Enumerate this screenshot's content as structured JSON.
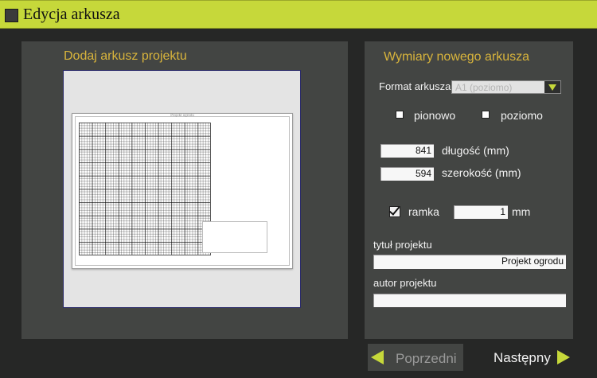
{
  "window": {
    "title": "Edycja arkusza"
  },
  "left_panel": {
    "title": "Dodaj arkusz projektu",
    "sheet_title": "Projekt ogrodu"
  },
  "right_panel": {
    "title": "Wymiary nowego arkusza",
    "format_label": "Format arkusza",
    "format_value": "A1 (poziomo)",
    "orientation": {
      "portrait": "pionowo",
      "landscape": "poziomo"
    },
    "length": {
      "value": "841",
      "label": "długość (mm)"
    },
    "width": {
      "value": "594",
      "label": "szerokość (mm)"
    },
    "frame": {
      "label": "ramka",
      "checked": true,
      "value": "1",
      "unit": "mm"
    },
    "project_title": {
      "label": "tytuł projektu",
      "value": "Projekt ogrodu"
    },
    "project_author": {
      "label": "autor projektu",
      "value": ""
    }
  },
  "navigation": {
    "prev": "Poprzedni",
    "next": "Następny"
  },
  "colors": {
    "accent": "#c6d83a",
    "heading": "#d8b43c",
    "panel": "#434543",
    "background": "#262726"
  }
}
